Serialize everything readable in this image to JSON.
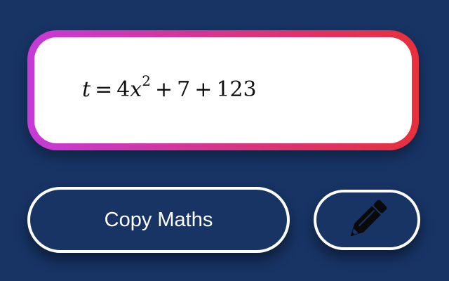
{
  "formula": {
    "lhs": "t",
    "equals": "=",
    "coef": "4",
    "base": "x",
    "exponent": "2",
    "plus1": "+",
    "term2": "7",
    "plus2": "+",
    "term3": "123"
  },
  "buttons": {
    "copy_label": "Copy Maths",
    "edit_icon": "pencil-icon"
  },
  "colors": {
    "background": "#173465",
    "frame_gradient_start": "#c63ad8",
    "frame_gradient_end": "#e8303a",
    "button_border": "#ffffff"
  }
}
